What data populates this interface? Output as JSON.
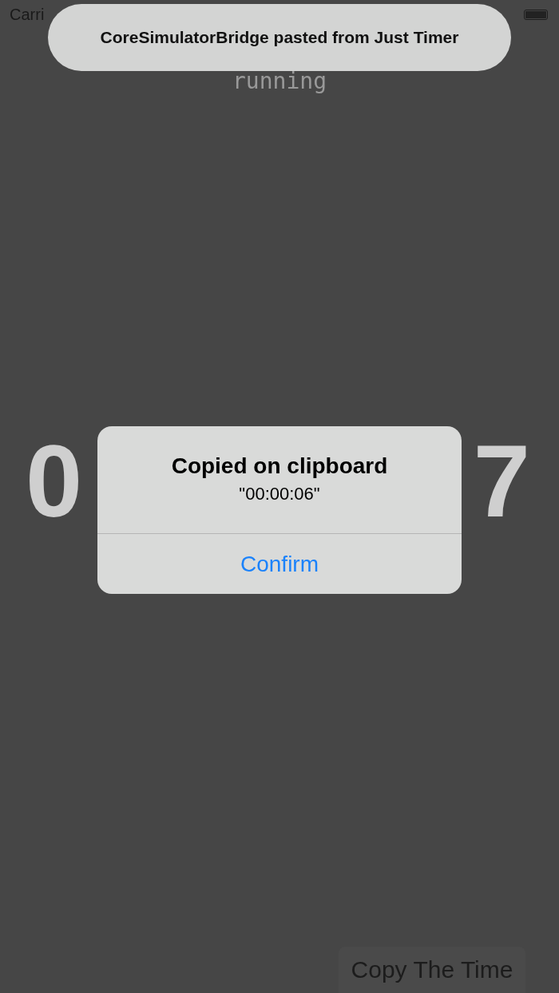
{
  "status_bar": {
    "carrier": "Carri"
  },
  "timer": {
    "state": "running",
    "digits": [
      "0",
      "7"
    ]
  },
  "copy_button": {
    "label": "Copy The Time"
  },
  "toast": {
    "text": "CoreSimulatorBridge pasted from Just Timer"
  },
  "alert": {
    "title": "Copied on clipboard",
    "message": "\"00:00:06\"",
    "buttons": [
      {
        "label": "Confirm"
      }
    ]
  }
}
